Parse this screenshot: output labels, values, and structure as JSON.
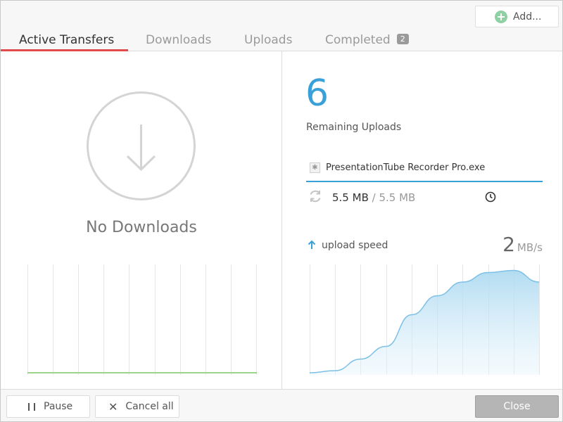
{
  "header": {
    "add_label": "Add...",
    "tabs": [
      {
        "label": "Active Transfers",
        "active": true
      },
      {
        "label": "Downloads"
      },
      {
        "label": "Uploads"
      },
      {
        "label": "Completed",
        "badge": "2"
      }
    ]
  },
  "downloads": {
    "empty_label": "No Downloads",
    "icon": "download-arrow-icon"
  },
  "uploads": {
    "remaining_count": "6",
    "remaining_label": "Remaining Uploads",
    "file": {
      "name": "PresentationTube Recorder Pro.exe",
      "icon": "file-icon"
    },
    "size_done": "5.5 MB",
    "size_separator": "/",
    "size_total": "5.5 MB",
    "speed_label": "upload speed",
    "speed_value": "2",
    "speed_unit": "MB/s",
    "speed_history": [
      0,
      0.02,
      0.13,
      0.25,
      0.55,
      0.73,
      0.86,
      0.95,
      0.97,
      0.86
    ]
  },
  "footer": {
    "pause_label": "Pause",
    "cancel_label": "Cancel all",
    "close_label": "Close"
  },
  "colors": {
    "accent_blue": "#3aa0d8",
    "tab_underline": "#e24b4b",
    "graph_green": "#9bd48a"
  }
}
